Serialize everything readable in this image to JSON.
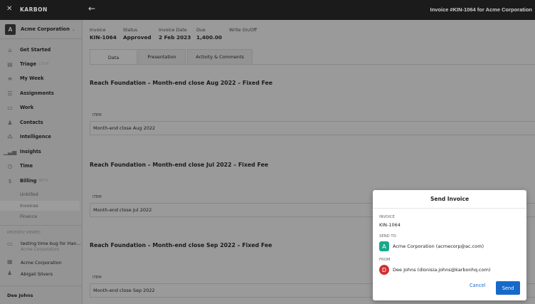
{
  "topbar": {
    "brand": "KARBON",
    "title": "Invoice #KIN-1064 for Acme Corporation"
  },
  "sidebar": {
    "org": {
      "initial": "A",
      "name": "Acme Corporation"
    },
    "items": [
      {
        "label": "Get Started",
        "icon": "home"
      },
      {
        "label": "Triage",
        "badge": "2,014",
        "icon": "triage"
      },
      {
        "label": "My Week",
        "icon": "list"
      },
      {
        "label": "Assignments",
        "icon": "assignments"
      },
      {
        "label": "Work",
        "icon": "briefcase"
      },
      {
        "label": "Contacts",
        "icon": "person"
      },
      {
        "label": "Intelligence",
        "icon": "network"
      },
      {
        "label": "Insights",
        "icon": "bar-chart"
      },
      {
        "label": "Time",
        "icon": "clock"
      },
      {
        "label": "Billing",
        "badge": "BETA",
        "icon": "dollar"
      }
    ],
    "billing_sub": [
      "Unbilled",
      "Invoices",
      "Finance"
    ],
    "recent_title": "RECENTLY VIEWED",
    "recent": [
      {
        "label": "testing time bug for Han...",
        "sub": "Acme Corporation",
        "icon": "briefcase"
      },
      {
        "label": "Acme Corporation",
        "icon": "building"
      },
      {
        "label": "Abigail Silvers",
        "icon": "person"
      }
    ],
    "user": "Dee Johns"
  },
  "header": [
    {
      "label": "Invoice",
      "value": "KIN-1064"
    },
    {
      "label": "Status",
      "value": "Approved"
    },
    {
      "label": "Invoice Date",
      "value": "2 Feb 2023"
    },
    {
      "label": "Due",
      "value": "1,400.00"
    },
    {
      "label": "Write On/Off",
      "value": ""
    }
  ],
  "tabs": [
    "Data",
    "Presentation",
    "Activity & Comments"
  ],
  "sections": [
    {
      "title": "Reach Foundation – Month-end close Aug 2022 – Fixed Fee",
      "item_label": "ITEM",
      "item": "Month-end close Aug 2022"
    },
    {
      "title": "Reach Foundation – Month-end close Jul 2022 – Fixed Fee",
      "item_label": "ITEM",
      "item": "Month-end close Jul 2022"
    },
    {
      "title": "Reach Foundation – Month-end close Sep 2022 – Fixed Fee",
      "item_label": "ITEM",
      "item": "Month-end close Sep 2022"
    }
  ],
  "modal": {
    "title": "Send Invoice",
    "invoice_label": "INVOICE",
    "invoice": "KIN-1064",
    "to_label": "SEND TO",
    "to_initial": "A",
    "to": "Acme Corporation (acmecorp@ac.com)",
    "from_label": "FROM",
    "from_initial": "D",
    "from": "Dee Johns (dionisia.johns@karbonhq.com)",
    "cancel": "Cancel",
    "send": "Send",
    "colors": {
      "to_avatar": "#1aa88a",
      "from_avatar": "#d42f2f",
      "primary": "#1769c9"
    }
  }
}
